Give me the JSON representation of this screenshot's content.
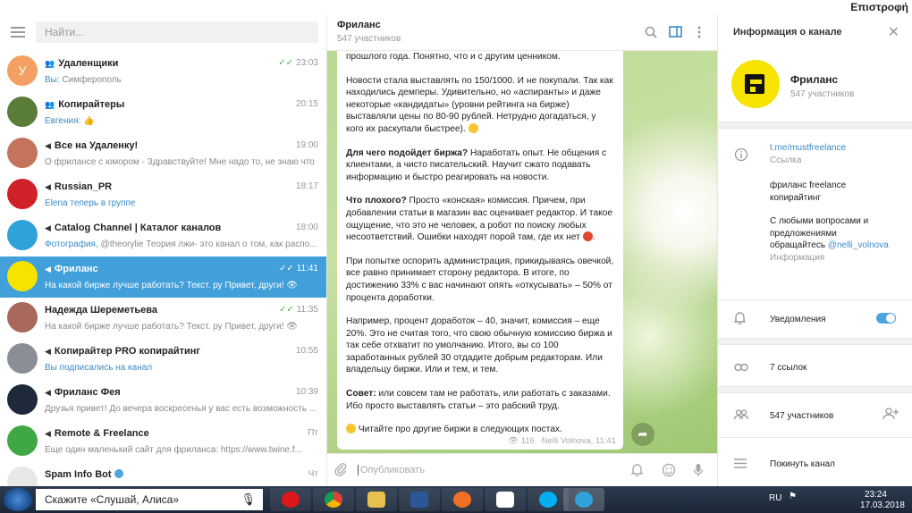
{
  "topbar": {
    "back": "Επιστροφή"
  },
  "sidebar": {
    "search_placeholder": "Найти...",
    "chats": [
      {
        "type": "group",
        "name": "Удаленщики",
        "time": "23:03",
        "check": "✓✓",
        "prefix": "Вы:",
        "preview": " Симферополь",
        "avatar_letter": "У",
        "avatar_color": "#f4a064"
      },
      {
        "type": "group",
        "name": "Копирайтеры",
        "time": "20:15",
        "prefix": "Евгения:",
        "preview": " 👍",
        "avatar_color": "#5a7d3a"
      },
      {
        "type": "channel",
        "name": "Все на Удаленку!",
        "time": "19:00",
        "preview": "О фрилансе с юмором  - Здравствуйте! Мне надо то, не знаю что",
        "avatar_color": "#c4735c"
      },
      {
        "type": "channel",
        "name": "Russian_PR",
        "time": "18:17",
        "prefix": "Elena теперь в группе",
        "preview": "",
        "avatar_color": "#d02028"
      },
      {
        "type": "channel",
        "name": "Catalog Channel | Каталог каналов",
        "time": "18:00",
        "prefix": "Фотография,",
        "preview": " @theorylie Теория лжи- это канал о том, как  распо...",
        "avatar_color": "#2fa3d9"
      },
      {
        "type": "channel",
        "name": "Фриланс",
        "time": "11:41",
        "check": "✓✓",
        "preview": "На какой бирже лучше работать? Текст. ру  Привет, други! 👁",
        "avatar_color": "#f6e300",
        "active": true
      },
      {
        "type": "user",
        "name": "Надежда Шереметьева",
        "time": "11:35",
        "check": "✓✓",
        "preview": "На какой бирже лучше работать? Текст. ру  Привет, други!  👁",
        "avatar_color": "#a8685a"
      },
      {
        "type": "channel",
        "name": "Копирайтер PRO копирайтинг",
        "time": "10:55",
        "prefix": "Вы подписались на канал",
        "preview": "",
        "avatar_color": "#8a8e96"
      },
      {
        "type": "channel",
        "name": "Фриланс Фея",
        "time": "10:39",
        "preview": "Друзья привет! До вечера воскресенья у вас есть возможность ...",
        "avatar_color": "#1e2a3a"
      },
      {
        "type": "channel",
        "name": "Remote & Freelance",
        "time": "Пт",
        "preview": "Еще один маленький сайт для фриланса: https://www.twine.f...",
        "avatar_color": "#3fa845"
      },
      {
        "type": "user",
        "name": "Spam Info Bot",
        "time": "Чт",
        "preview": "",
        "avatar_color": "#e8e8e8"
      }
    ]
  },
  "chat": {
    "title": "Фриланс",
    "subtitle": "547 участников",
    "composer_placeholder": "Опубликовать",
    "message": {
      "p0": "прошлого года. Понятно, что и с другим ценником.",
      "p1": "Новости стала выставлять по 150/1000. И не покупали. Так как находились демперы. Удивительно, но «аспиранты» и даже некоторые «кандидаты» (уровни рейтинга на бирже) выставляли цены по 80-90 рублей. Нетрудно догадаться, у кого их раскупали быстрее).",
      "p2_bold": "Для чего подойдет биржа?",
      "p2": " Наработать опыт. Не общения с клиентами, а чисто писательский. Научит сжато подавать информацию и быстро реагировать на новости.",
      "p3_bold": "Что плохого?",
      "p3": " Просто «конская» комиссия. Причем, при добавлении статьи в магазин вас оценивает редактор. И такое ощущение, что это не человек, а робот по поиску любых несоответствий. Ошибки находят порой там, где их нет",
      "p4": "При попытке оспорить администрация, прикидываясь овечкой, все равно принимает сторону редактора. В итоге, по достижению 33% с вас начинают опять «откусывать» – 50% от процента доработки.",
      "p5": " Например, процент доработок – 40, значит, комиссия – еще 20%. Это не считая того, что свою обычную комиссию биржа и так себе отхватит по умолчанию. Итого, вы со 100 заработанных рублей 30  отдадите добрым редакторам. Или владельцу биржи. Или и тем, и тем.",
      "p6_bold": "Совет:",
      "p6": " или совсем там не работать, или работать с заказами. Ибо просто выставлять статьи – это рабский труд.",
      "p7": " Читайте про другие биржи в следующих постах.",
      "views": "116",
      "author_time": "Nelli Volnova, 11:41"
    }
  },
  "info": {
    "title": "Информация о канале",
    "name": "Фриланс",
    "members": "547 участников",
    "link": "t.me/mustfreelance",
    "link_label": "Ссылка",
    "desc1": "фриланс freelance",
    "desc2": "копирайтинг",
    "desc3": "С любыми вопросами и",
    "desc4": "предложениями",
    "desc5": "обращайтесь",
    "desc_link": "@nelli_volnova",
    "desc_label": "Информация",
    "notifications": "Уведомления",
    "notifications_on": true,
    "links": "7 ссылок",
    "participants": "547 участников",
    "leave": "Покинуть канал"
  },
  "taskbar": {
    "search": "Скажите «Слушай, Алиса»",
    "lang": "RU",
    "time": "23:24",
    "date": "17.03.2018"
  },
  "colors": {
    "accent": "#419fd9",
    "online_check": "#4fae4e",
    "channel_avatar": "#f6e300"
  }
}
